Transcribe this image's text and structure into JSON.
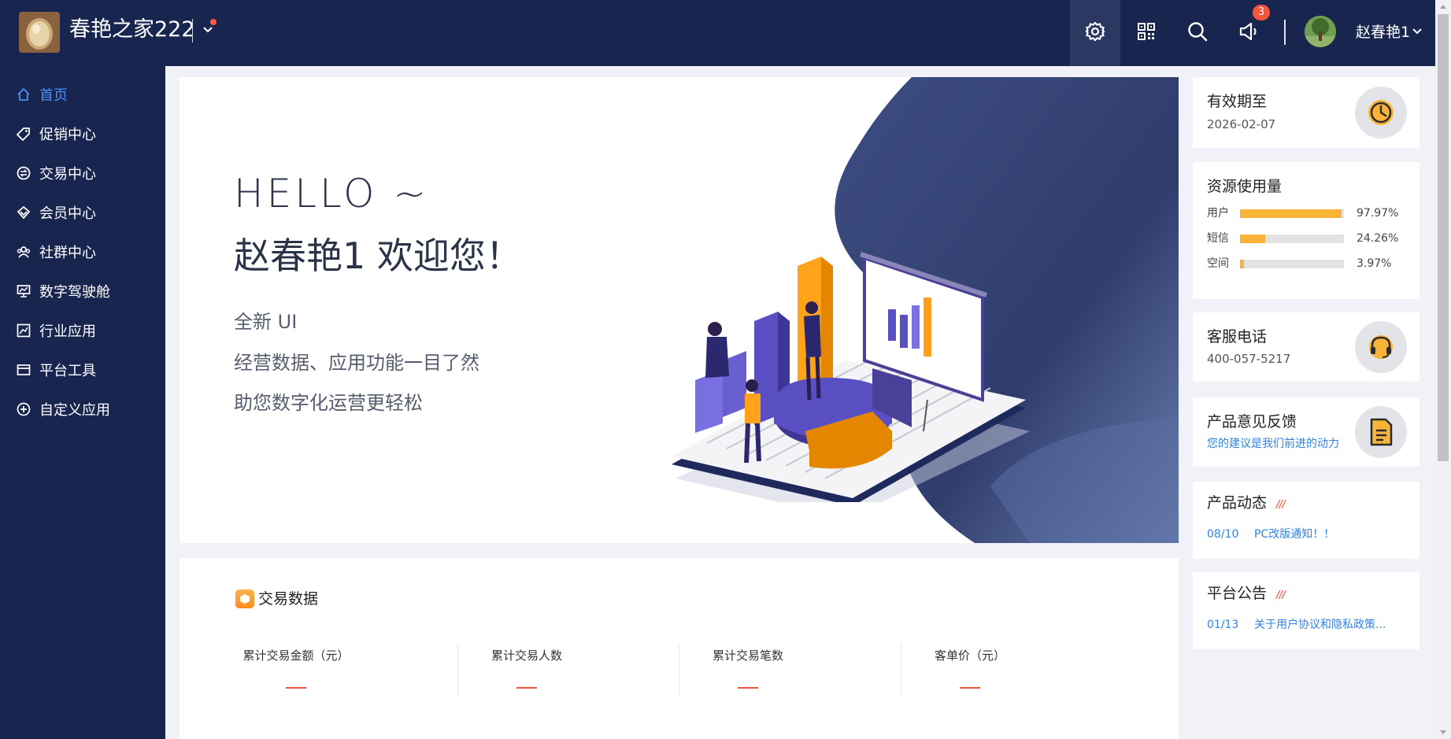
{
  "header": {
    "store_name": "春艳之家222",
    "user_name": "赵春艳1",
    "notification_count": "3",
    "icons": [
      "gear-icon",
      "qrcode-icon",
      "search-icon",
      "megaphone-icon"
    ]
  },
  "sidebar": {
    "items": [
      {
        "label": "首页",
        "icon": "home-icon"
      },
      {
        "label": "促销中心",
        "icon": "tag-icon"
      },
      {
        "label": "交易中心",
        "icon": "exchange-icon"
      },
      {
        "label": "会员中心",
        "icon": "diamond-icon"
      },
      {
        "label": "社群中心",
        "icon": "community-icon"
      },
      {
        "label": "数字驾驶舱",
        "icon": "dashboard-icon"
      },
      {
        "label": "行业应用",
        "icon": "chart-icon"
      },
      {
        "label": "平台工具",
        "icon": "toolbox-icon"
      },
      {
        "label": "自定义应用",
        "icon": "plus-circle-icon"
      }
    ]
  },
  "hero": {
    "hello": "HELLO ~",
    "welcome": "赵春艳1 欢迎您！",
    "lines": [
      "全新 UI",
      "经营数据、应用功能一目了然",
      "助您数字化运营更轻松"
    ]
  },
  "trade": {
    "title": "交易数据",
    "metrics": [
      {
        "label": "累计交易金额（元）"
      },
      {
        "label": "累计交易人数"
      },
      {
        "label": "累计交易笔数"
      },
      {
        "label": "客单价（元）"
      }
    ]
  },
  "validity": {
    "title": "有效期至",
    "date": "2026-02-07"
  },
  "resources": {
    "title": "资源使用量",
    "rows": [
      {
        "label": "用户",
        "percent": "97.97%",
        "fraction": 0.9797
      },
      {
        "label": "短信",
        "percent": "24.26%",
        "fraction": 0.2426
      },
      {
        "label": "空间",
        "percent": "3.97%",
        "fraction": 0.0397
      }
    ],
    "bar_color": "#f9b437"
  },
  "service": {
    "title": "客服电话",
    "phone": "400-057-5217"
  },
  "feedback": {
    "title": "产品意见反馈",
    "link": "您的建议是我们前进的动力"
  },
  "product_news": {
    "title": "产品动态",
    "items": [
      {
        "date": "08/10",
        "text": "PC改版通知！！"
      }
    ]
  },
  "announcements": {
    "title": "平台公告",
    "items": [
      {
        "date": "01/13",
        "text": "关于用户协议和隐私政策..."
      }
    ]
  },
  "colors": {
    "nav_bg": "#17254f",
    "active": "#4a8ff7",
    "accent": "#f9b437",
    "link": "#2f83e6"
  }
}
